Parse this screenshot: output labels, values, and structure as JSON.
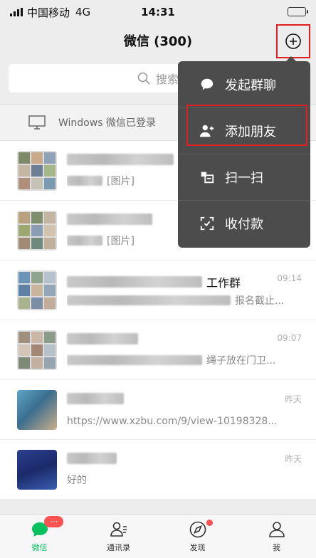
{
  "status_bar": {
    "carrier": "中国移动",
    "network": "4G",
    "time": "14:31"
  },
  "header": {
    "title": "微信 (300)",
    "add_icon": "plus-circle-icon"
  },
  "search": {
    "placeholder": "搜索"
  },
  "windows_login": {
    "text": "Windows 微信已登录"
  },
  "chats": [
    {
      "name_suffix": "",
      "time": "",
      "preview_suffix": "[图片]",
      "avatar": "group"
    },
    {
      "name_suffix": "",
      "time": "",
      "preview_suffix": "[图片]",
      "avatar": "group"
    },
    {
      "name_suffix": "工作群",
      "time": "09:14",
      "preview_suffix": "报名截止...",
      "avatar": "group"
    },
    {
      "name_suffix": "",
      "time": "09:07",
      "preview_suffix": "绳子放在门卫...",
      "avatar": "group"
    },
    {
      "name_suffix": "",
      "time": "昨天",
      "preview_suffix": "https://www.xzbu.com/9/view-10198328...",
      "avatar": "single"
    },
    {
      "name_suffix": "",
      "time": "昨天",
      "preview_suffix": "好的",
      "avatar": "single-blue"
    }
  ],
  "menu": {
    "items": [
      {
        "label": "发起群聊",
        "icon": "chat-bubble-icon"
      },
      {
        "label": "添加朋友",
        "icon": "add-friend-icon"
      },
      {
        "label": "扫一扫",
        "icon": "scan-icon"
      },
      {
        "label": "收付款",
        "icon": "payment-icon"
      }
    ]
  },
  "tabs": [
    {
      "label": "微信",
      "badge": "···",
      "icon": "chat-icon",
      "active": true
    },
    {
      "label": "通讯录",
      "icon": "contacts-icon"
    },
    {
      "label": "发现",
      "icon": "compass-icon"
    },
    {
      "label": "我",
      "icon": "person-icon"
    }
  ],
  "colors": {
    "accent": "#07c160",
    "menu_bg": "#4c4c4c",
    "highlight": "#e02020",
    "badge": "#fa5151"
  }
}
